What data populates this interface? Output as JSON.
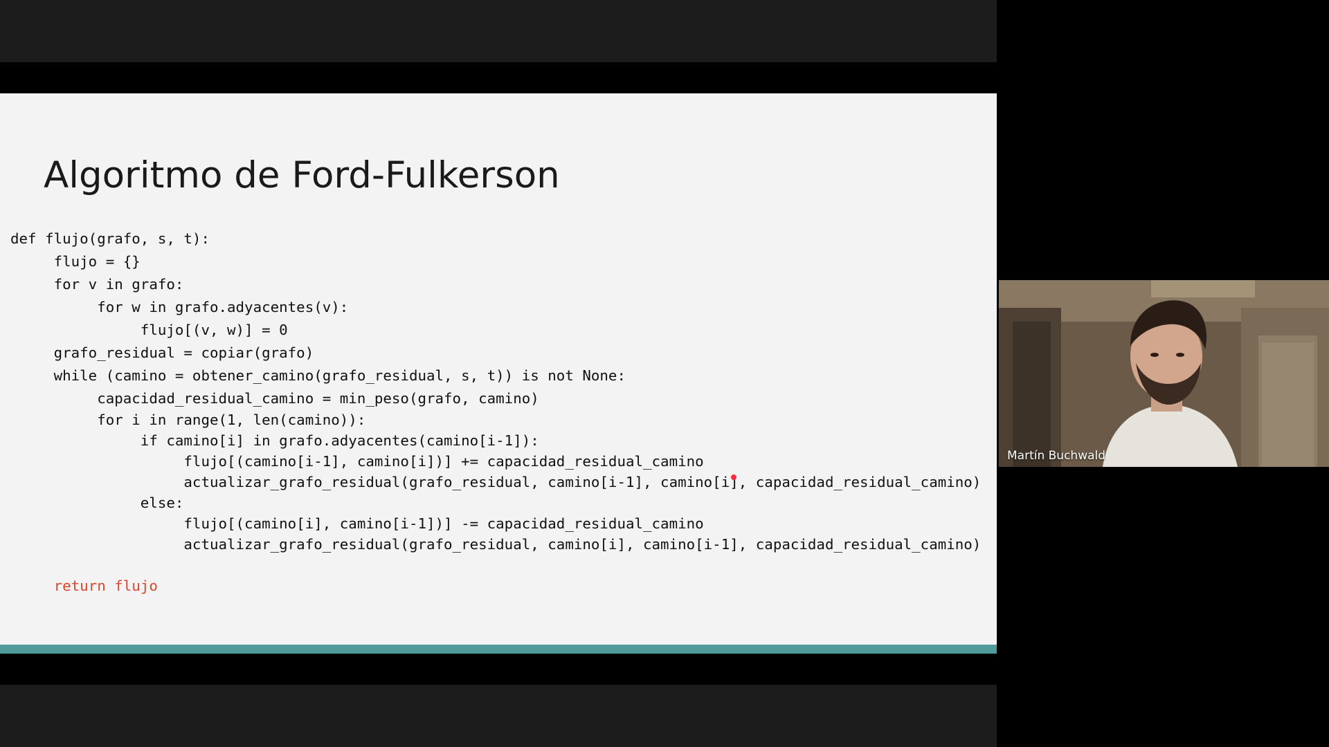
{
  "slide": {
    "title": "Algoritmo de Ford-Fulkerson",
    "code_lines": [
      "def flujo(grafo, s, t):",
      "     flujo = {}",
      "     for v in grafo:",
      "          for w in grafo.adyacentes(v):",
      "               flujo[(v, w)] = 0",
      "     grafo_residual = copiar(grafo)",
      "     while (camino = obtener_camino(grafo_residual, s, t)) is not None:",
      "          capacidad_residual_camino = min_peso(grafo, camino)",
      "          for i in range(1, len(camino)):",
      "               if camino[i] in grafo.adyacentes(camino[i-1]):",
      "                    flujo[(camino[i-1], camino[i])] += capacidad_residual_camino",
      "                    actualizar_grafo_residual(grafo_residual, camino[i-1], camino[i], capacidad_residual_camino)",
      "               else:",
      "                    flujo[(camino[i], camino[i-1])] -= capacidad_residual_camino",
      "                    actualizar_grafo_residual(grafo_residual, camino[i], camino[i-1], capacidad_residual_camino)",
      "     return flujo"
    ],
    "return_color": "#e0442a",
    "accent_color": "#4f9a9a",
    "pointer_color": "#ff2a3c"
  },
  "webcam": {
    "participant_name": "Martín Buchwald"
  }
}
